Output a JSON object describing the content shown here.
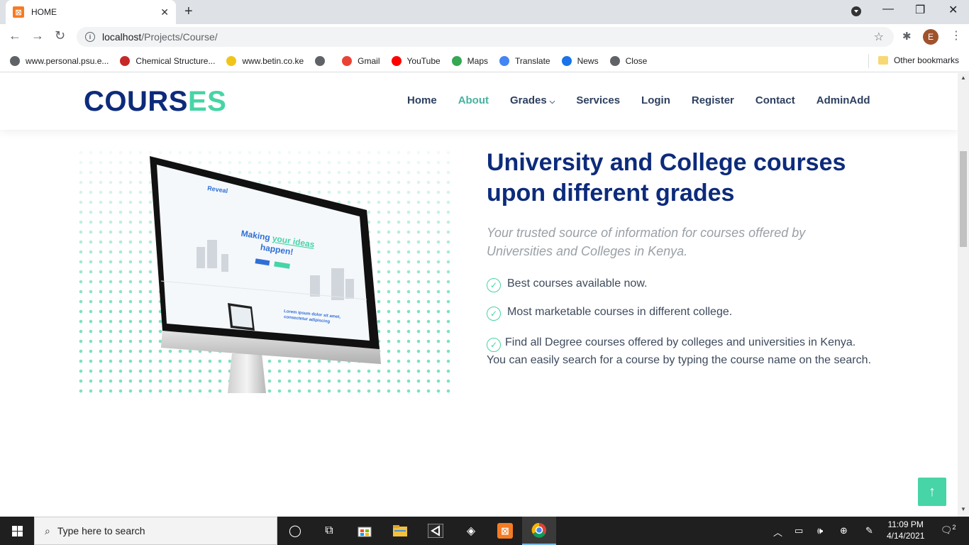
{
  "browser": {
    "tab_title": "HOME",
    "tab_favicon": "xampp-icon",
    "url_host": "localhost",
    "url_path": "/Projects/Course/",
    "avatar_letter": "E",
    "bookmarks": [
      {
        "label": "www.personal.psu.e...",
        "icon": "globe-icon",
        "color": "#5f6368"
      },
      {
        "label": "Chemical Structure...",
        "icon": "chemical-icon",
        "color": "#c62828"
      },
      {
        "label": "www.betin.co.ke",
        "icon": "betin-icon",
        "color": "#f0c419"
      },
      {
        "label": "",
        "icon": "globe-icon",
        "color": "#5f6368"
      },
      {
        "label": "Gmail",
        "icon": "gmail-icon",
        "color": "#ea4335"
      },
      {
        "label": "YouTube",
        "icon": "youtube-icon",
        "color": "#ff0000"
      },
      {
        "label": "Maps",
        "icon": "maps-icon",
        "color": "#34a853"
      },
      {
        "label": "Translate",
        "icon": "translate-icon",
        "color": "#4285f4"
      },
      {
        "label": "News",
        "icon": "news-icon",
        "color": "#1a73e8"
      },
      {
        "label": "Close",
        "icon": "globe-icon",
        "color": "#5f6368"
      }
    ],
    "other_bookmarks": "Other bookmarks"
  },
  "site": {
    "logo_part1": "COURS",
    "logo_part2": "ES",
    "nav": [
      {
        "label": "Home",
        "active": false
      },
      {
        "label": "About",
        "active": true
      },
      {
        "label": "Grades",
        "active": false,
        "dropdown": true
      },
      {
        "label": "Services",
        "active": false
      },
      {
        "label": "Login",
        "active": false
      },
      {
        "label": "Register",
        "active": false
      },
      {
        "label": "Contact",
        "active": false
      },
      {
        "label": "AdminAdd",
        "active": false
      }
    ]
  },
  "hero": {
    "title": "University and College courses upon different grades",
    "subtitle": "Your trusted source of information for courses offered by Universities and Colleges in Kenya.",
    "features": [
      "Best courses available now.",
      "Most marketable courses in different college.",
      "Find all Degree courses offered by colleges and universities in Kenya. You can easily search for a course by typing the course name on the search."
    ],
    "monitor_screen": {
      "brand": "Reveal",
      "headline_a": "Making ",
      "headline_b": "your ideas",
      "headline_c": "happen!",
      "lorem": "Lorem ipsum dolor sit amet, consectetur adipiscing"
    }
  },
  "taskbar": {
    "search_placeholder": "Type here to search",
    "time": "11:09 PM",
    "date": "4/14/2021",
    "notifications": "2"
  },
  "colors": {
    "brand_dark": "#0d2b7b",
    "brand_accent": "#47d4a6",
    "nav_active": "#47b2a0"
  }
}
